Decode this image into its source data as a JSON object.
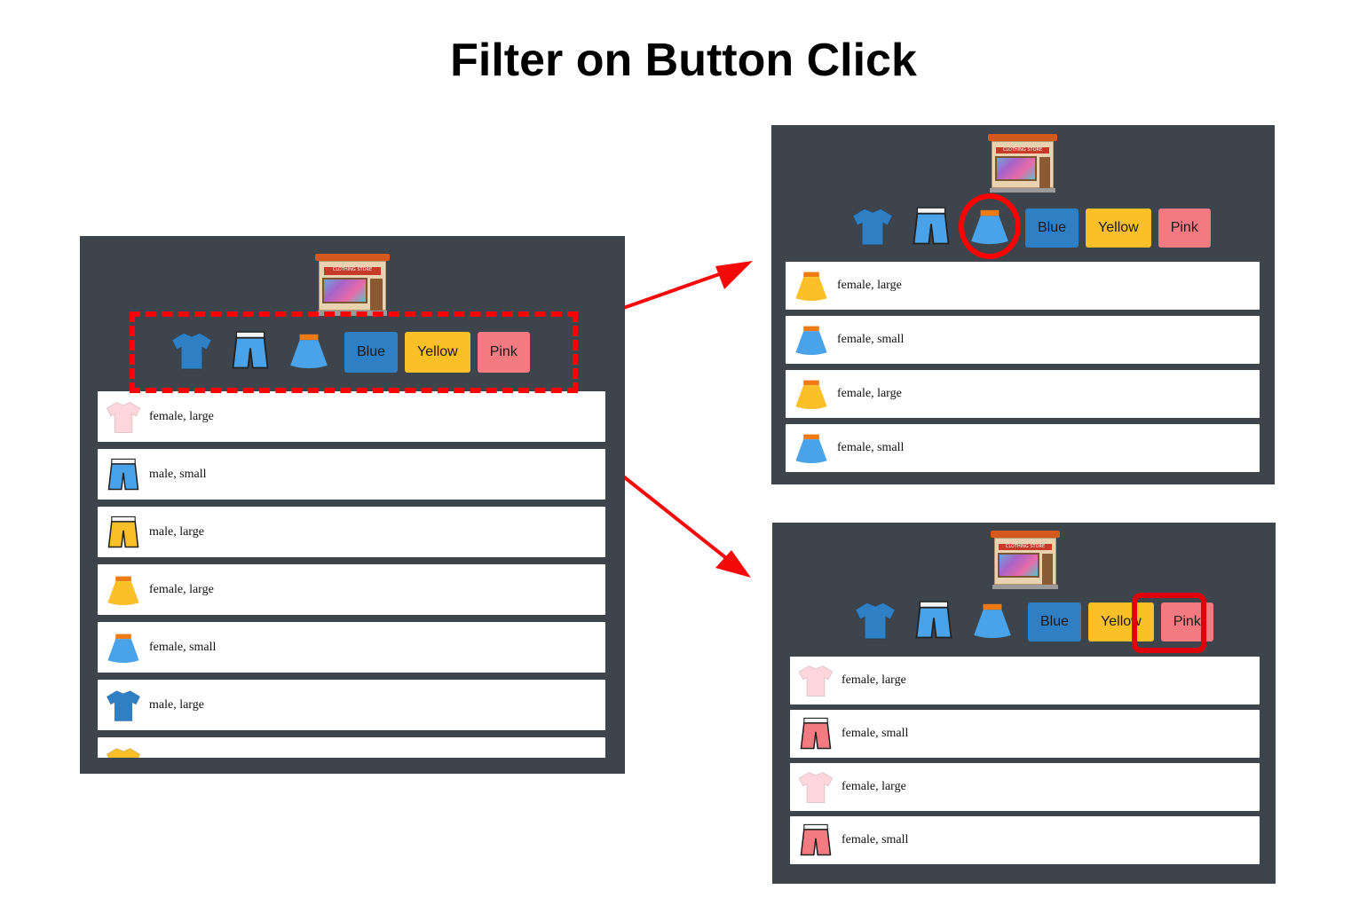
{
  "title": "Filter on Button Click",
  "store_sign": "CLOTHING STORE",
  "colors": {
    "blue": "#2f7fc4",
    "yellow": "#fbbf28",
    "pink": "#f47a82",
    "highlight": "#ff0000",
    "panel": "#3e444c"
  },
  "filters": {
    "icons": [
      "tshirt-icon",
      "shorts-icon",
      "skirt-icon"
    ],
    "blue_label": "Blue",
    "yellow_label": "Yellow",
    "pink_label": "Pink"
  },
  "main_list": [
    {
      "icon": "tshirt-icon",
      "color": "pink",
      "label": "female, large"
    },
    {
      "icon": "shorts-icon",
      "color": "blue",
      "label": "male, small"
    },
    {
      "icon": "shorts-icon",
      "color": "yellow",
      "label": "male, large"
    },
    {
      "icon": "skirt-icon",
      "color": "yellow",
      "label": "female, large"
    },
    {
      "icon": "skirt-icon",
      "color": "blue",
      "label": "female, small"
    },
    {
      "icon": "tshirt-icon",
      "color": "blue",
      "label": "male, large"
    },
    {
      "icon": "tshirt-icon",
      "color": "yellow",
      "label": ""
    }
  ],
  "skirt_list": [
    {
      "icon": "skirt-icon",
      "color": "yellow",
      "label": "female, large"
    },
    {
      "icon": "skirt-icon",
      "color": "blue",
      "label": "female, small"
    },
    {
      "icon": "skirt-icon",
      "color": "yellow",
      "label": "female, large"
    },
    {
      "icon": "skirt-icon",
      "color": "blue",
      "label": "female, small"
    }
  ],
  "pink_list": [
    {
      "icon": "tshirt-icon",
      "color": "pink",
      "label": "female, large"
    },
    {
      "icon": "shorts-icon",
      "color": "pink",
      "label": "female, small"
    },
    {
      "icon": "tshirt-icon",
      "color": "pink",
      "label": "female, large"
    },
    {
      "icon": "shorts-icon",
      "color": "pink",
      "label": "female, small"
    }
  ]
}
